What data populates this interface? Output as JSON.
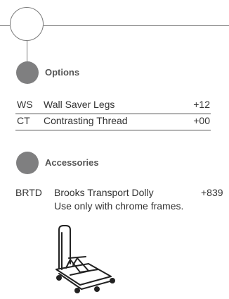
{
  "options": {
    "title": "Options",
    "items": [
      {
        "code": "WS",
        "name": "Wall Saver Legs",
        "price": "+12"
      },
      {
        "code": "CT",
        "name": "Contrasting Thread",
        "price": "+00"
      }
    ]
  },
  "accessories": {
    "title": "Accessories",
    "items": [
      {
        "code": "BRTD",
        "name": "Brooks Transport Dolly",
        "price": "+839",
        "note": "Use only with chrome frames."
      }
    ]
  },
  "icons": {
    "header_circle": "circle-outline-icon",
    "section_marker": "filled-circle-icon",
    "product": "transport-dolly-illustration"
  }
}
